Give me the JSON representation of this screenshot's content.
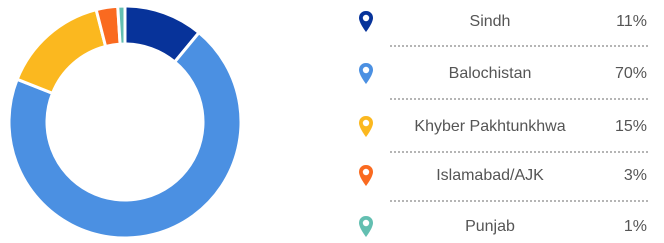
{
  "chart_data": {
    "type": "pie",
    "donut": true,
    "categories": [
      "Sindh",
      "Balochistan",
      "Khyber Pakhtunkhwa",
      "Islamabad/AJK",
      "Punjab"
    ],
    "values": [
      11,
      70,
      15,
      3,
      1
    ],
    "value_labels": [
      "11%",
      "70%",
      "15%",
      "3%",
      "1%"
    ],
    "colors": [
      "#07339a",
      "#4b90e2",
      "#fbb81f",
      "#fa6a20",
      "#63bfb1"
    ],
    "legend_placement": "right",
    "legend_icon": "map-pin-icon"
  },
  "legend": [
    {
      "label": "Sindh",
      "value": "11%",
      "icon": "map-pin-icon",
      "color": "#07339a"
    },
    {
      "label": "Balochistan",
      "value": "70%",
      "icon": "map-pin-icon",
      "color": "#4b90e2"
    },
    {
      "label": "Khyber Pakhtunkhwa",
      "value": "15%",
      "icon": "map-pin-icon",
      "color": "#fbb81f"
    },
    {
      "label": "Islamabad/AJK",
      "value": "3%",
      "icon": "map-pin-icon",
      "color": "#fa6a20"
    },
    {
      "label": "Punjab",
      "value": "1%",
      "icon": "map-pin-icon",
      "color": "#63bfb1"
    }
  ]
}
